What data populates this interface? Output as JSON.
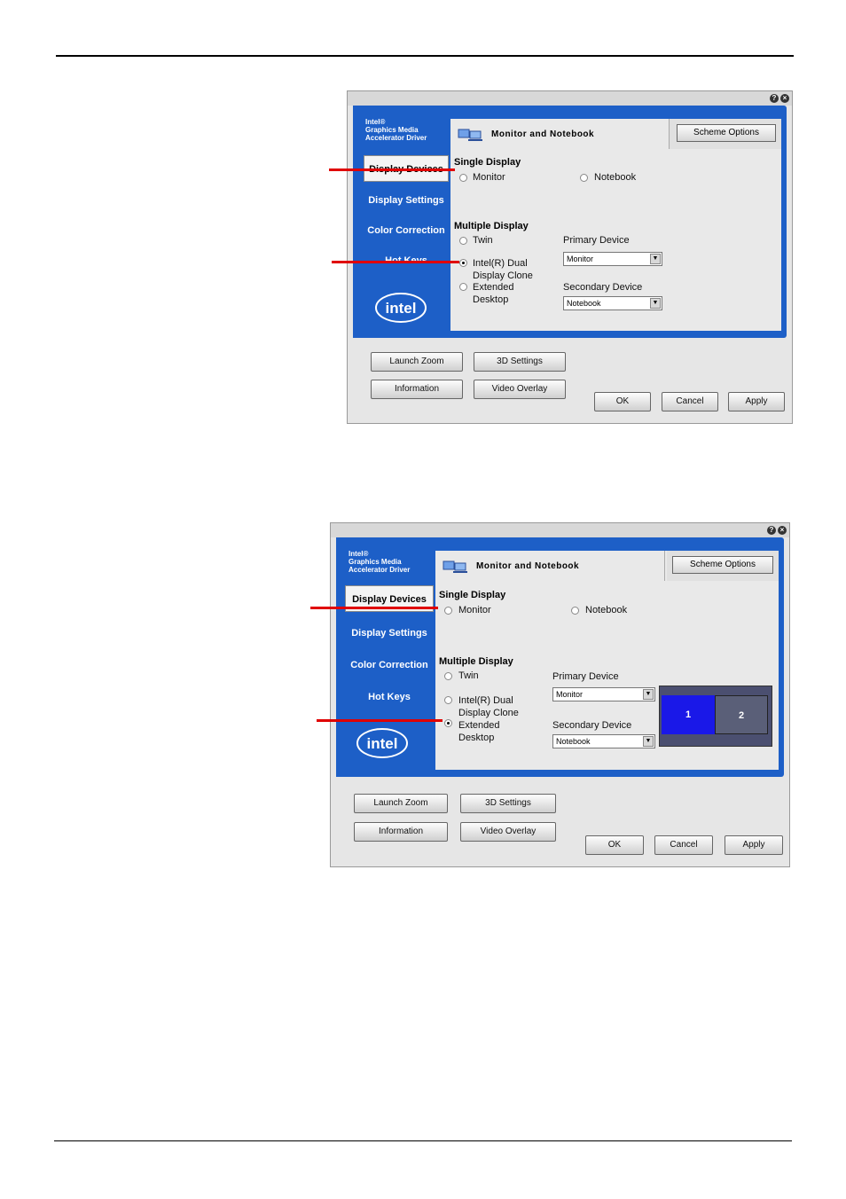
{
  "dialog_top": {
    "brand": "Intel®\nGraphics Media\nAccelerator Driver",
    "nav": [
      "Display Devices",
      "Display Settings",
      "Color Correction",
      "Hot Keys"
    ],
    "pane_title": "Monitor and Notebook",
    "scheme_button": "Scheme Options",
    "single_display": "Single Display",
    "single_options": [
      "Monitor",
      "Notebook"
    ],
    "multiple_display": "Multiple Display",
    "multi_options": [
      "Twin",
      "Intel(R) Dual Display Clone",
      "Extended Desktop"
    ],
    "selected_multi": "Intel(R) Dual Display Clone",
    "primary_label": "Primary Device",
    "primary_value": "Monitor",
    "secondary_label": "Secondary Device",
    "secondary_value": "Notebook",
    "buttons": {
      "launch_zoom": "Launch Zoom",
      "3d_settings": "3D Settings",
      "information": "Information",
      "video_overlay": "Video Overlay",
      "ok": "OK",
      "cancel": "Cancel",
      "apply": "Apply"
    }
  },
  "dialog_bottom": {
    "brand": "Intel®\nGraphics Media\nAccelerator Driver",
    "nav": [
      "Display Devices",
      "Display Settings",
      "Color Correction",
      "Hot Keys"
    ],
    "pane_title": "Monitor and Notebook",
    "scheme_button": "Scheme Options",
    "single_display": "Single Display",
    "single_options": [
      "Monitor",
      "Notebook"
    ],
    "multiple_display": "Multiple Display",
    "multi_options": [
      "Twin",
      "Intel(R) Dual Display Clone",
      "Extended Desktop"
    ],
    "selected_multi": "Extended Desktop",
    "primary_label": "Primary Device",
    "primary_value": "Monitor",
    "secondary_label": "Secondary Device",
    "secondary_value": "Notebook",
    "preview": {
      "primary": "1",
      "secondary": "2"
    },
    "buttons": {
      "launch_zoom": "Launch Zoom",
      "3d_settings": "3D Settings",
      "information": "Information",
      "video_overlay": "Video Overlay",
      "ok": "OK",
      "cancel": "Cancel",
      "apply": "Apply"
    }
  },
  "colors": {
    "accent": "#1d5fc7",
    "marker": "#e00000",
    "preview_primary": "#1a18e8",
    "preview_secondary": "#5a5f78"
  }
}
